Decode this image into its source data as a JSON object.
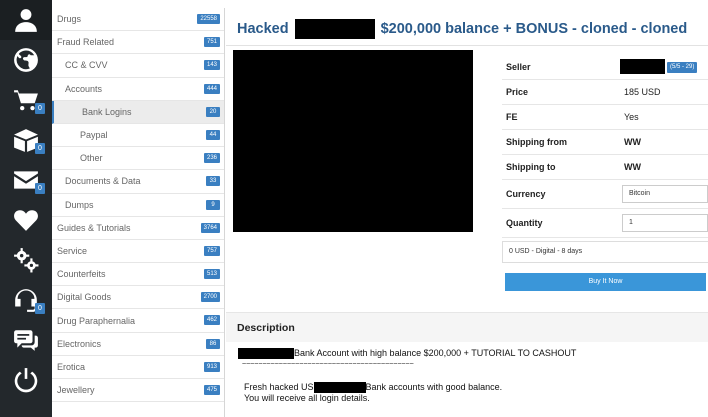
{
  "rail": {
    "items": [
      {
        "icon": "user-icon",
        "badge": ""
      },
      {
        "icon": "globe-icon",
        "badge": ""
      },
      {
        "icon": "cart-icon",
        "badge": "0"
      },
      {
        "icon": "box-icon",
        "badge": "0"
      },
      {
        "icon": "mail-icon",
        "badge": "0"
      },
      {
        "icon": "heart-icon",
        "badge": ""
      },
      {
        "icon": "gears-icon",
        "badge": ""
      },
      {
        "icon": "headset-icon",
        "badge": "0"
      },
      {
        "icon": "chat-icon",
        "badge": ""
      },
      {
        "icon": "power-icon",
        "badge": ""
      }
    ]
  },
  "categories": [
    {
      "label": "Drugs",
      "count": "22558",
      "level": 0
    },
    {
      "label": "Fraud Related",
      "count": "751",
      "level": 0
    },
    {
      "label": "CC & CVV",
      "count": "143",
      "level": 1
    },
    {
      "label": "Accounts",
      "count": "444",
      "level": 1
    },
    {
      "label": "Bank Logins",
      "count": "20",
      "level": 2,
      "active": true
    },
    {
      "label": "Paypal",
      "count": "44",
      "level": 2
    },
    {
      "label": "Other",
      "count": "236",
      "level": 2
    },
    {
      "label": "Documents & Data",
      "count": "33",
      "level": 1
    },
    {
      "label": "Dumps",
      "count": "9",
      "level": 1
    },
    {
      "label": "Guides & Tutorials",
      "count": "3764",
      "level": 0
    },
    {
      "label": "Service",
      "count": "757",
      "level": 0
    },
    {
      "label": "Counterfeits",
      "count": "513",
      "level": 0
    },
    {
      "label": "Digital Goods",
      "count": "2700",
      "level": 0
    },
    {
      "label": "Drug Paraphernalia",
      "count": "462",
      "level": 0
    },
    {
      "label": "Electronics",
      "count": "86",
      "level": 0
    },
    {
      "label": "Erotica",
      "count": "913",
      "level": 0
    },
    {
      "label": "Jewellery",
      "count": "475",
      "level": 0
    }
  ],
  "listing": {
    "title_prefix": "Hacked",
    "title_suffix": "$200,000 balance + BONUS - cloned - cloned",
    "seller_label": "Seller",
    "seller_badge": "(5/5 - 29)",
    "price_label": "Price",
    "price_value": "185 USD",
    "fe_label": "FE",
    "fe_value": "Yes",
    "ship_from_label": "Shipping from",
    "ship_from_value": "WW",
    "ship_to_label": "Shipping to",
    "ship_to_value": "WW",
    "currency_label": "Currency",
    "currency_value": "Bitcoin",
    "quantity_label": "Quantity",
    "quantity_value": "1",
    "shipping_option": "0 USD - Digital - 8 days",
    "buy_label": "Buy It Now"
  },
  "description": {
    "heading": "Description",
    "line1": "Bank Account with high balance $200,000 + TUTORIAL TO CASHOUT",
    "line2": "~~~~~~~~~~~~~~~~~~~~~~~~~~~~~~~~~~~~~~~~~~",
    "line3_prefix": "Fresh hacked US",
    "line3_suffix": "Bank accounts with good balance.",
    "line4": "You will receive all login details."
  },
  "colors": {
    "accent": "#3a7fc1",
    "title": "#2a5a8a",
    "rail": "#23282c",
    "buy_button": "#3a96d9"
  }
}
